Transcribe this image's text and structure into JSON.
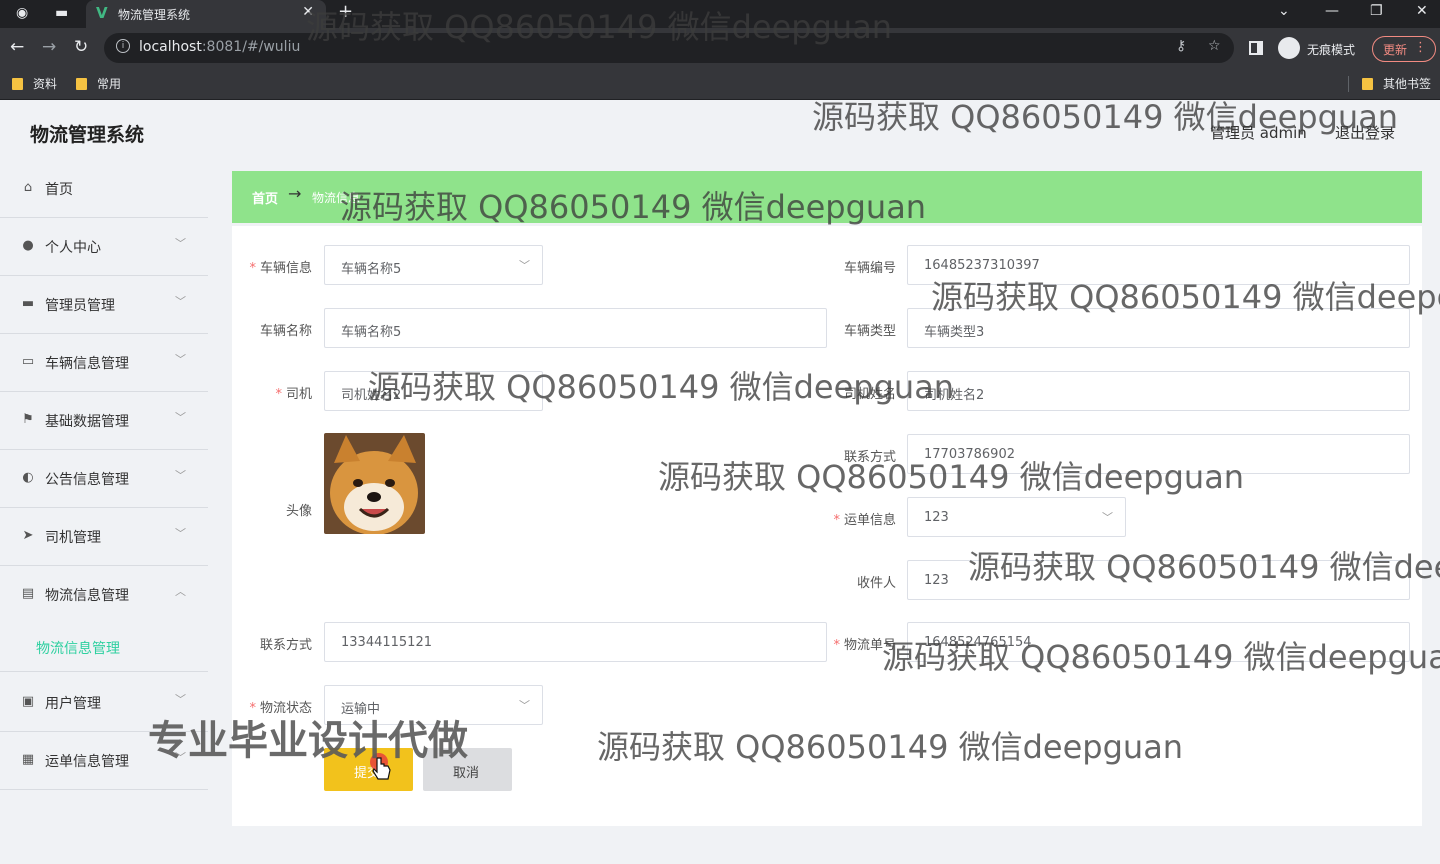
{
  "browser": {
    "tab_title": "物流管理系统",
    "url_host": "localhost",
    "url_rest": ":8081/#/wuliu",
    "incognito_label": "无痕模式",
    "update_label": "更新",
    "bookmarks": [
      "资料",
      "常用"
    ],
    "other_bookmarks": "其他书签"
  },
  "app": {
    "brand": "物流管理系统",
    "user_label": "管理员 admin",
    "logout_label": "退出登录",
    "breadcrumb": {
      "home": "首页",
      "arrow": "→",
      "current": "物流信息"
    }
  },
  "sidebar": {
    "items": [
      {
        "label": "首页",
        "icon": "home-icon",
        "chevron": ""
      },
      {
        "label": "个人中心",
        "icon": "person-icon",
        "chevron": "﹀"
      },
      {
        "label": "管理员管理",
        "icon": "admin-icon",
        "chevron": "﹀"
      },
      {
        "label": "车辆信息管理",
        "icon": "chat-icon",
        "chevron": "﹀"
      },
      {
        "label": "基础数据管理",
        "icon": "flag-icon",
        "chevron": "﹀"
      },
      {
        "label": "公告信息管理",
        "icon": "bulb-icon",
        "chevron": "﹀"
      },
      {
        "label": "司机管理",
        "icon": "send-icon",
        "chevron": "﹀"
      },
      {
        "label": "物流信息管理",
        "icon": "monitor-icon",
        "chevron": "︿"
      },
      {
        "label": "用户管理",
        "icon": "chart-icon",
        "chevron": "﹀"
      },
      {
        "label": "运单信息管理",
        "icon": "ticket-icon",
        "chevron": "﹀"
      }
    ],
    "sub_item": "物流信息管理"
  },
  "form": {
    "vehicle_info": {
      "label": "车辆信息",
      "value": "车辆名称5"
    },
    "vehicle_no": {
      "label": "车辆编号",
      "value": "16485237310397"
    },
    "vehicle_name": {
      "label": "车辆名称",
      "value": "车辆名称5"
    },
    "vehicle_type": {
      "label": "车辆类型",
      "value": "车辆类型3"
    },
    "driver": {
      "label": "司机",
      "value": "司机姓名2"
    },
    "driver_name": {
      "label": "司机姓名",
      "value": "司机姓名2"
    },
    "avatar": {
      "label": "头像"
    },
    "driver_phone": {
      "label": "联系方式",
      "value": "17703786902"
    },
    "waybill_info": {
      "label": "运单信息",
      "value": "123"
    },
    "receiver": {
      "label": "收件人",
      "value": "123"
    },
    "receiver_phone": {
      "label": "联系方式",
      "value": "13344115121"
    },
    "logistics_no": {
      "label": "物流单号",
      "value": "1648524765154"
    },
    "logistics_status": {
      "label": "物流状态",
      "value": "运输中"
    },
    "submit_label": "提交",
    "cancel_label": "取消"
  },
  "watermark": {
    "text": "源码获取 QQ86050149 微信deepguan",
    "text_cut1": "源码获取 QQ86050149 微信deepgua",
    "text_cut2": "源码获取 QQ86050149 微信deepg",
    "big_text": "专业毕业设计代做"
  },
  "colors": {
    "breadcrumb_bg": "#8fe38b",
    "submit_bg": "#f2c21c",
    "active_submenu": "#2ed0a0",
    "required": "#f56c6c"
  }
}
